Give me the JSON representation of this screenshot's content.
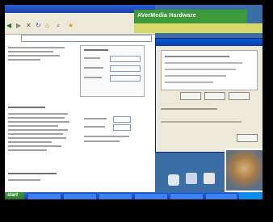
{
  "browser": {
    "title": "",
    "menu": "",
    "address": ""
  },
  "banner": {
    "text": "AVerMedia   Hardware"
  },
  "strip": {
    "text": ""
  },
  "dialog": {
    "title": ""
  },
  "taskbar": {
    "start_label": "start",
    "clock": ""
  },
  "colors": {
    "taskbar": "#1941a5",
    "start": "#3c9a3a",
    "banner": "#3c9a3a",
    "desktop": "#3a6ea5"
  }
}
